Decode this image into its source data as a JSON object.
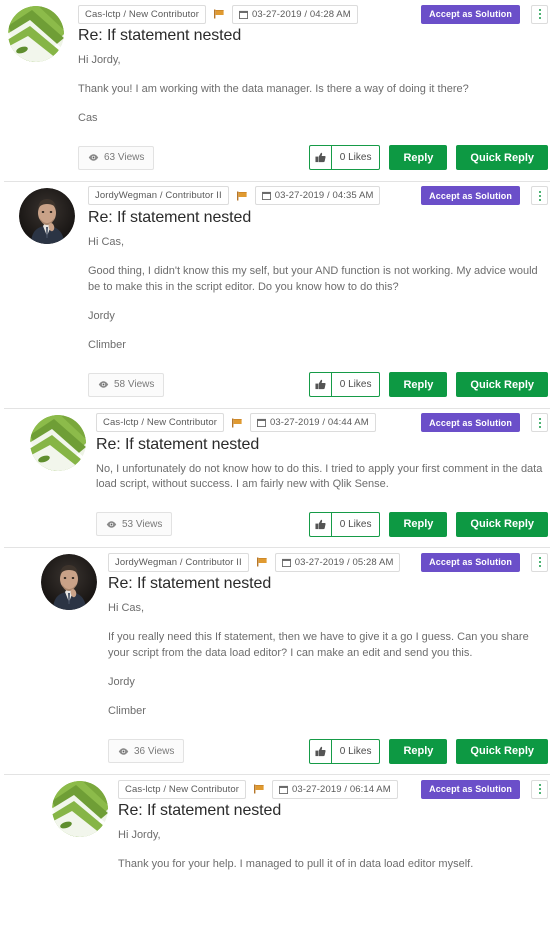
{
  "thread": {
    "accept_label": "Accept as Solution",
    "reply_label": "Reply",
    "quick_reply_label": "Quick Reply",
    "kebab_label": "more-options",
    "posts": [
      {
        "author_badge": "Cas-lctp / New Contributor",
        "timestamp": "03-27-2019 / 04:28 AM",
        "title": "Re: If statement nested",
        "paragraphs": [
          "Hi Jordy,",
          "Thank you! I am working with the data manager. Is there a way of doing it there?",
          "Cas"
        ],
        "views": "63 Views",
        "likes": "0 Likes",
        "avatar": "green-abstract",
        "indent": 8,
        "content_indent": 78
      },
      {
        "author_badge": "JordyWegman / Contributor II",
        "timestamp": "03-27-2019 / 04:35 AM",
        "title": "Re: If statement nested",
        "paragraphs": [
          "Hi Cas,",
          "Good thing, I didn't know this my self, but your AND function is not working. My advice would be to make this in the script editor. Do you know how to do this?",
          "Jordy",
          "Climber"
        ],
        "views": "58 Views",
        "likes": "0 Likes",
        "avatar": "photo-portrait",
        "indent": 19,
        "content_indent": 88
      },
      {
        "author_badge": "Cas-lctp / New Contributor",
        "timestamp": "03-27-2019 / 04:44 AM",
        "title": "Re: If statement nested",
        "paragraphs": [
          "No, I unfortunately do not know how to do this.  I tried to apply your first comment in the data load script, without success. I am fairly new with Qlik Sense."
        ],
        "views": "53 Views",
        "likes": "0 Likes",
        "avatar": "green-abstract",
        "indent": 30,
        "content_indent": 96
      },
      {
        "author_badge": "JordyWegman / Contributor II",
        "timestamp": "03-27-2019 / 05:28 AM",
        "title": "Re: If statement nested",
        "paragraphs": [
          "Hi Cas,",
          "If you really need this If statement, then we have to give it a go I guess. Can you share your script from the data load editor? I can make an edit and send you this.",
          "Jordy",
          "Climber"
        ],
        "views": "36 Views",
        "likes": "0 Likes",
        "avatar": "photo-portrait",
        "indent": 41,
        "content_indent": 108
      },
      {
        "author_badge": "Cas-lctp / New Contributor",
        "timestamp": "03-27-2019 / 06:14 AM",
        "title": "Re: If statement nested",
        "paragraphs": [
          "Hi Jordy,",
          "Thank you for your help. I managed to pull it of in data load editor myself."
        ],
        "views": "",
        "likes": "",
        "avatar": "green-abstract",
        "indent": 52,
        "content_indent": 118,
        "truncated": true
      }
    ]
  },
  "colors": {
    "accept_purple": "#6b4fc9",
    "button_green": "#0d9943",
    "likes_border_green": "#169b47",
    "flag_orange": "#d98c27",
    "title_text": "#2b2b2b",
    "body_text": "#6d6d6d",
    "separator": "#e3e3e3"
  },
  "icons": {
    "flag": "flag-icon",
    "calendar": "calendar-icon",
    "eye": "eye-icon",
    "thumbs_up": "thumbs-up-icon",
    "kebab": "kebab-menu-icon"
  }
}
